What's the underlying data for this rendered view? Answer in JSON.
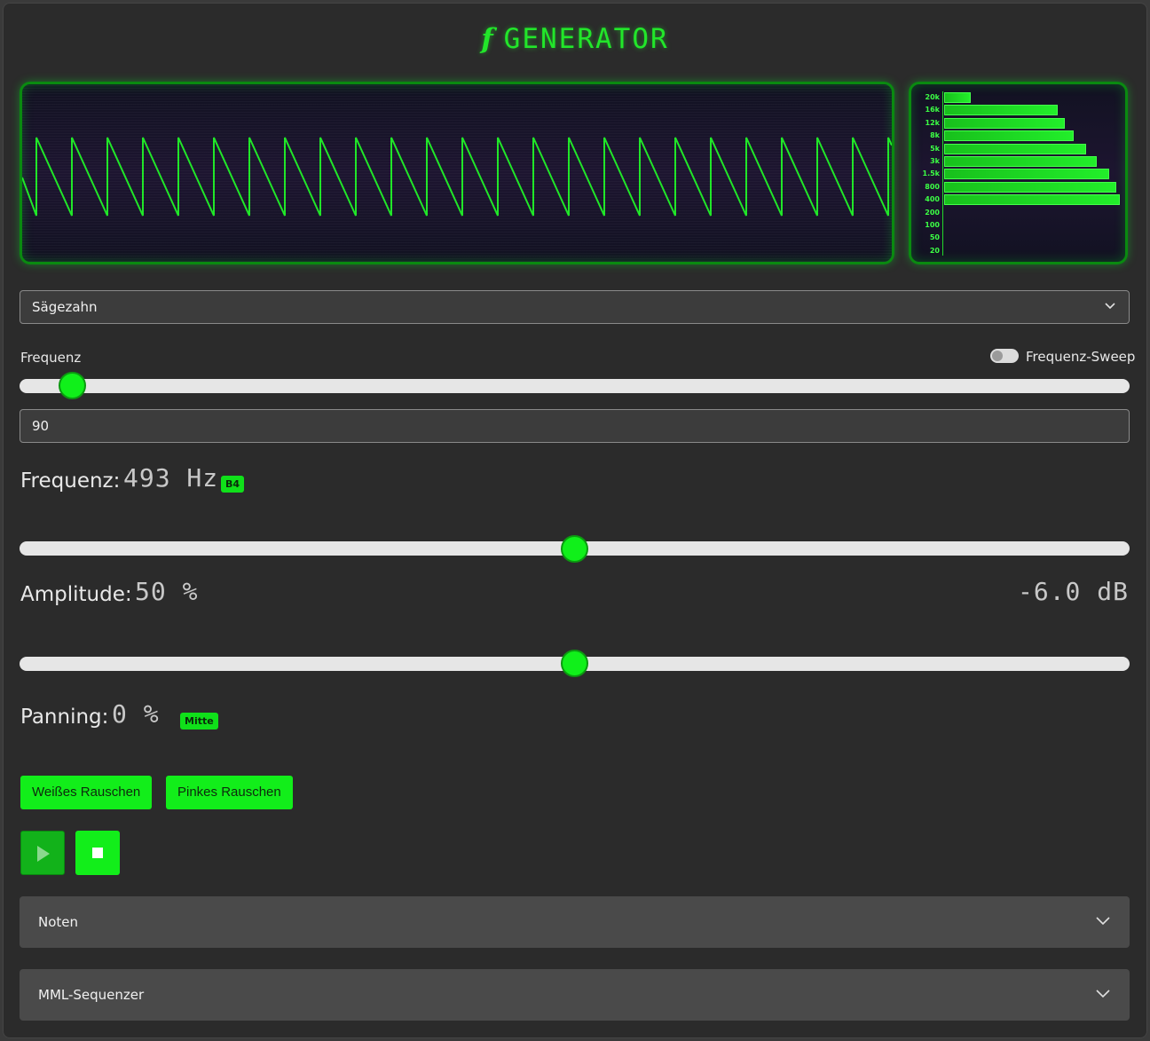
{
  "app": {
    "title": "GENERATOR",
    "title_glyph": "f",
    "accent_color": "#12ee1a"
  },
  "oscilloscope": {
    "waveform": "sawtooth",
    "cycles_visible": 24.5
  },
  "spectrum": {
    "bands": [
      {
        "label": "20k",
        "level": 0.15
      },
      {
        "label": "16k",
        "level": 0.64
      },
      {
        "label": "12k",
        "level": 0.68
      },
      {
        "label": "8k",
        "level": 0.73
      },
      {
        "label": "5k",
        "level": 0.8
      },
      {
        "label": "3k",
        "level": 0.86
      },
      {
        "label": "1.5k",
        "level": 0.93
      },
      {
        "label": "800",
        "level": 0.97
      },
      {
        "label": "400",
        "level": 0.99
      },
      {
        "label": "200",
        "level": 0
      },
      {
        "label": "100",
        "level": 0
      },
      {
        "label": "50",
        "level": 0
      },
      {
        "label": "20",
        "level": 0
      }
    ]
  },
  "waveform_select": {
    "value": "Sägezahn",
    "icon": "chevron-down-icon"
  },
  "frequency": {
    "label": "Frequenz",
    "sweep_label": "Frequenz-Sweep",
    "sweep_on": false,
    "slider_value": 0.036,
    "input_value": "90",
    "display_label": "Frequenz:",
    "display_value": "493 Hz",
    "note": "B4"
  },
  "amplitude": {
    "slider_value": 0.5,
    "display_label": "Amplitude:",
    "display_value": "50 %",
    "db_value": "-6.0 dB"
  },
  "panning": {
    "slider_value": 0.5,
    "display_label": "Panning:",
    "display_value": "0 %",
    "position_badge": "Mitte"
  },
  "noise_buttons": {
    "white": "Weißes Rauschen",
    "pink": "Pinkes Rauschen"
  },
  "transport": {
    "play_icon": "play-icon",
    "stop_icon": "stop-icon"
  },
  "panels": {
    "notes": "Noten",
    "mml": "MML-Sequenzer"
  }
}
